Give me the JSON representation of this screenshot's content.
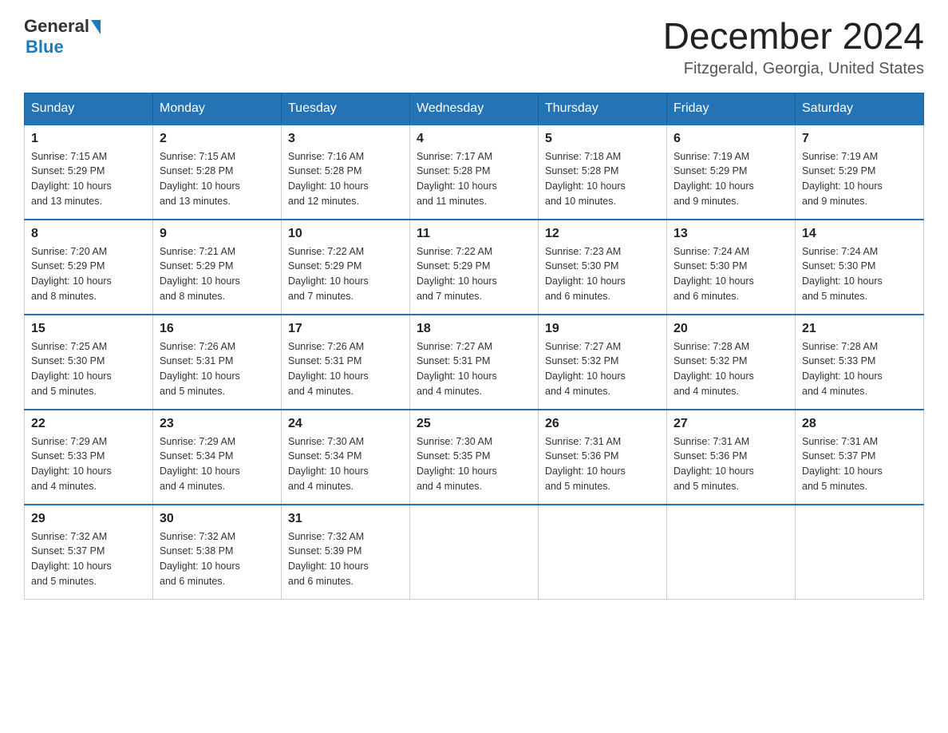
{
  "header": {
    "logo_general": "General",
    "logo_blue": "Blue",
    "month_year": "December 2024",
    "location": "Fitzgerald, Georgia, United States"
  },
  "days_of_week": [
    "Sunday",
    "Monday",
    "Tuesday",
    "Wednesday",
    "Thursday",
    "Friday",
    "Saturday"
  ],
  "weeks": [
    [
      {
        "day": "1",
        "sunrise": "7:15 AM",
        "sunset": "5:29 PM",
        "daylight": "10 hours and 13 minutes."
      },
      {
        "day": "2",
        "sunrise": "7:15 AM",
        "sunset": "5:28 PM",
        "daylight": "10 hours and 13 minutes."
      },
      {
        "day": "3",
        "sunrise": "7:16 AM",
        "sunset": "5:28 PM",
        "daylight": "10 hours and 12 minutes."
      },
      {
        "day": "4",
        "sunrise": "7:17 AM",
        "sunset": "5:28 PM",
        "daylight": "10 hours and 11 minutes."
      },
      {
        "day": "5",
        "sunrise": "7:18 AM",
        "sunset": "5:28 PM",
        "daylight": "10 hours and 10 minutes."
      },
      {
        "day": "6",
        "sunrise": "7:19 AM",
        "sunset": "5:29 PM",
        "daylight": "10 hours and 9 minutes."
      },
      {
        "day": "7",
        "sunrise": "7:19 AM",
        "sunset": "5:29 PM",
        "daylight": "10 hours and 9 minutes."
      }
    ],
    [
      {
        "day": "8",
        "sunrise": "7:20 AM",
        "sunset": "5:29 PM",
        "daylight": "10 hours and 8 minutes."
      },
      {
        "day": "9",
        "sunrise": "7:21 AM",
        "sunset": "5:29 PM",
        "daylight": "10 hours and 8 minutes."
      },
      {
        "day": "10",
        "sunrise": "7:22 AM",
        "sunset": "5:29 PM",
        "daylight": "10 hours and 7 minutes."
      },
      {
        "day": "11",
        "sunrise": "7:22 AM",
        "sunset": "5:29 PM",
        "daylight": "10 hours and 7 minutes."
      },
      {
        "day": "12",
        "sunrise": "7:23 AM",
        "sunset": "5:30 PM",
        "daylight": "10 hours and 6 minutes."
      },
      {
        "day": "13",
        "sunrise": "7:24 AM",
        "sunset": "5:30 PM",
        "daylight": "10 hours and 6 minutes."
      },
      {
        "day": "14",
        "sunrise": "7:24 AM",
        "sunset": "5:30 PM",
        "daylight": "10 hours and 5 minutes."
      }
    ],
    [
      {
        "day": "15",
        "sunrise": "7:25 AM",
        "sunset": "5:30 PM",
        "daylight": "10 hours and 5 minutes."
      },
      {
        "day": "16",
        "sunrise": "7:26 AM",
        "sunset": "5:31 PM",
        "daylight": "10 hours and 5 minutes."
      },
      {
        "day": "17",
        "sunrise": "7:26 AM",
        "sunset": "5:31 PM",
        "daylight": "10 hours and 4 minutes."
      },
      {
        "day": "18",
        "sunrise": "7:27 AM",
        "sunset": "5:31 PM",
        "daylight": "10 hours and 4 minutes."
      },
      {
        "day": "19",
        "sunrise": "7:27 AM",
        "sunset": "5:32 PM",
        "daylight": "10 hours and 4 minutes."
      },
      {
        "day": "20",
        "sunrise": "7:28 AM",
        "sunset": "5:32 PM",
        "daylight": "10 hours and 4 minutes."
      },
      {
        "day": "21",
        "sunrise": "7:28 AM",
        "sunset": "5:33 PM",
        "daylight": "10 hours and 4 minutes."
      }
    ],
    [
      {
        "day": "22",
        "sunrise": "7:29 AM",
        "sunset": "5:33 PM",
        "daylight": "10 hours and 4 minutes."
      },
      {
        "day": "23",
        "sunrise": "7:29 AM",
        "sunset": "5:34 PM",
        "daylight": "10 hours and 4 minutes."
      },
      {
        "day": "24",
        "sunrise": "7:30 AM",
        "sunset": "5:34 PM",
        "daylight": "10 hours and 4 minutes."
      },
      {
        "day": "25",
        "sunrise": "7:30 AM",
        "sunset": "5:35 PM",
        "daylight": "10 hours and 4 minutes."
      },
      {
        "day": "26",
        "sunrise": "7:31 AM",
        "sunset": "5:36 PM",
        "daylight": "10 hours and 5 minutes."
      },
      {
        "day": "27",
        "sunrise": "7:31 AM",
        "sunset": "5:36 PM",
        "daylight": "10 hours and 5 minutes."
      },
      {
        "day": "28",
        "sunrise": "7:31 AM",
        "sunset": "5:37 PM",
        "daylight": "10 hours and 5 minutes."
      }
    ],
    [
      {
        "day": "29",
        "sunrise": "7:32 AM",
        "sunset": "5:37 PM",
        "daylight": "10 hours and 5 minutes."
      },
      {
        "day": "30",
        "sunrise": "7:32 AM",
        "sunset": "5:38 PM",
        "daylight": "10 hours and 6 minutes."
      },
      {
        "day": "31",
        "sunrise": "7:32 AM",
        "sunset": "5:39 PM",
        "daylight": "10 hours and 6 minutes."
      },
      null,
      null,
      null,
      null
    ]
  ],
  "labels": {
    "sunrise": "Sunrise:",
    "sunset": "Sunset:",
    "daylight": "Daylight:"
  }
}
